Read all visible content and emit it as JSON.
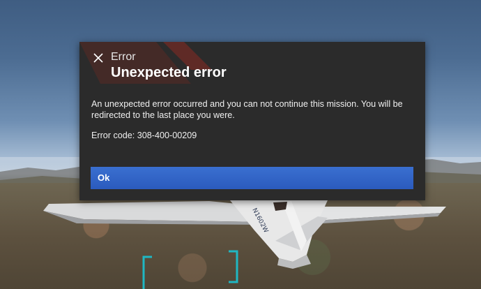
{
  "dialog": {
    "category": "Error",
    "title": "Unexpected error",
    "message": "An unexpected error occurred and you can not continue this mission. You will be redirected to the last place you were.",
    "error_code": "Error code: 308-400-00209",
    "ok_label": "Ok",
    "close_icon": "close-icon"
  },
  "background": {
    "aircraft_registration": "N1602W"
  },
  "colors": {
    "dialog_bg": "#2b2b2b",
    "accent_blue": "#2f62c6",
    "deco_red": "#8b2a22",
    "hud_cyan": "#1fb7c3"
  }
}
